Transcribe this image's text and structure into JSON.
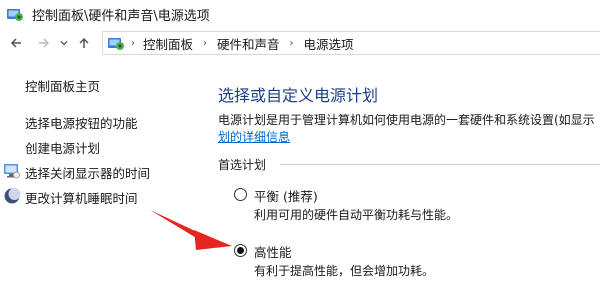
{
  "window": {
    "title": "控制面板\\硬件和声音\\电源选项",
    "app_icon": "control-panel-icon"
  },
  "nav": {
    "back_icon": "back-arrow-icon",
    "forward_icon": "forward-arrow-icon",
    "recent_icon": "chevron-down-icon",
    "up_icon": "up-arrow-icon"
  },
  "address": {
    "crumbs": [
      "控制面板",
      "硬件和声音",
      "电源选项"
    ],
    "separator": "›"
  },
  "sidebar": {
    "home": "控制面板主页",
    "items": [
      {
        "label": "选择电源按钮的功能",
        "icon": ""
      },
      {
        "label": "创建电源计划",
        "icon": ""
      },
      {
        "label": "选择关闭显示器的时间",
        "icon": "display-power-icon"
      },
      {
        "label": "更改计算机睡眠时间",
        "icon": "sleep-moon-icon"
      }
    ]
  },
  "main": {
    "heading": "选择或自定义电源计划",
    "description": "电源计划是用于管理计算机如何使用电源的一套硬件和系统设置(如显示",
    "description_link": "划的详细信息",
    "group_label": "首选计划",
    "plans": [
      {
        "name": "平衡 (推荐)",
        "description": "利用可用的硬件自动平衡功耗与性能。",
        "selected": false
      },
      {
        "name": "高性能",
        "description": "有利于提高性能，但会增加功耗。",
        "selected": true
      }
    ]
  },
  "colors": {
    "heading": "#1e3f8a",
    "link": "#0066cc",
    "annotation_arrow": "#e5261f"
  }
}
